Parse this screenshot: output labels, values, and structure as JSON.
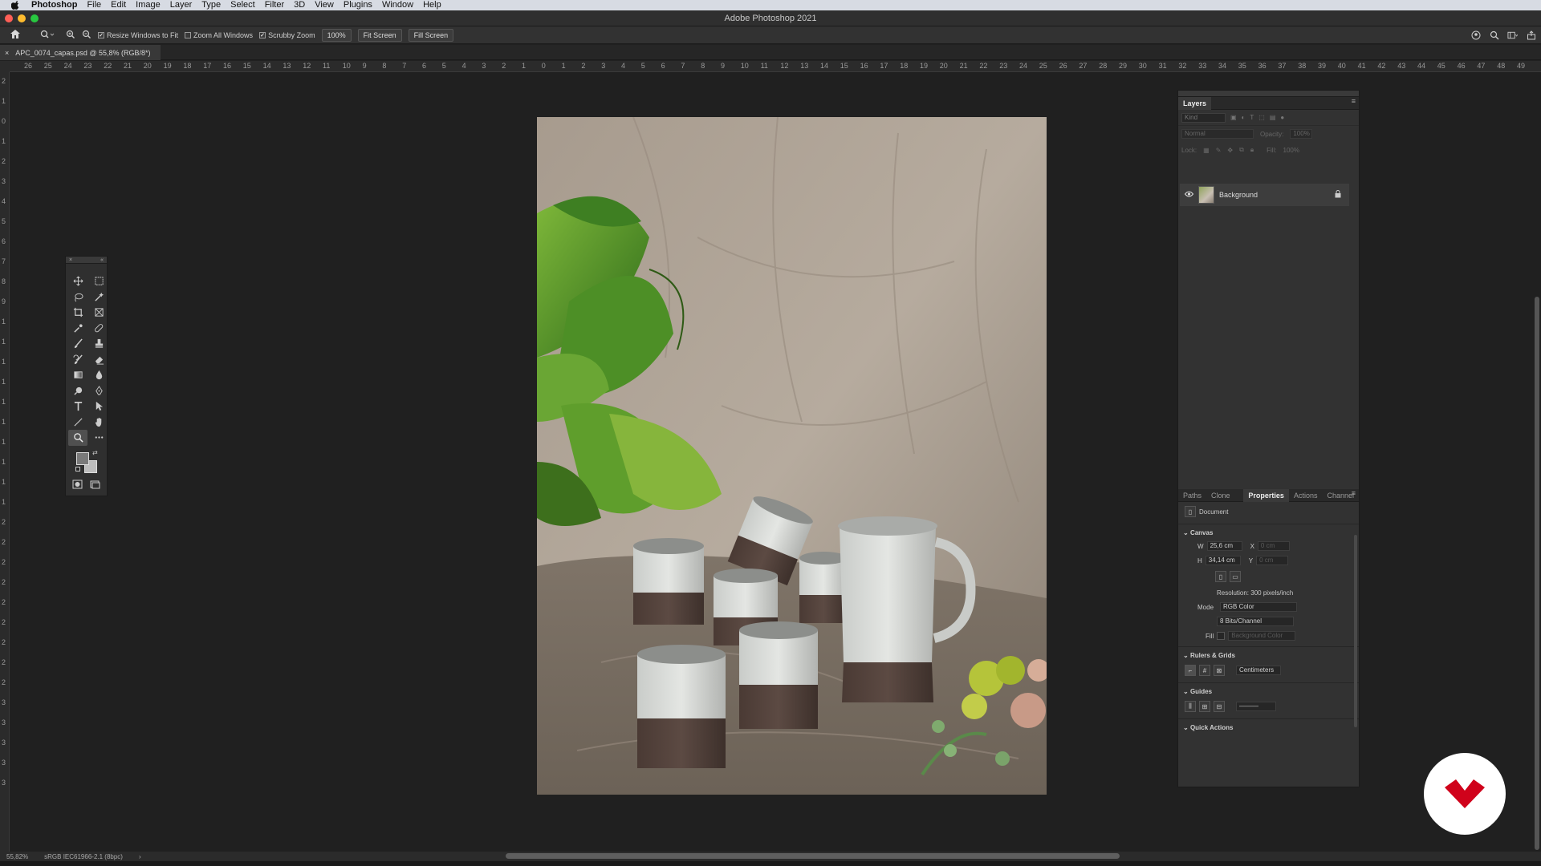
{
  "menubar": {
    "app_name": "Photoshop",
    "items": [
      "File",
      "Edit",
      "Image",
      "Layer",
      "Type",
      "Select",
      "Filter",
      "3D",
      "View",
      "Plugins",
      "Window",
      "Help"
    ]
  },
  "window": {
    "title": "Adobe Photoshop 2021"
  },
  "options_bar": {
    "resize_windows": "Resize Windows to Fit",
    "zoom_all": "Zoom All Windows",
    "scrubby_zoom": "Scrubby Zoom",
    "zoom_value": "100%",
    "fit_screen": "Fit Screen",
    "fill_screen": "Fill Screen",
    "resize_checked": true,
    "zoom_all_checked": false,
    "scrubby_checked": true
  },
  "document_tab": {
    "title": "APC_0074_capas.psd @ 55,8% (RGB/8*)",
    "close": "×"
  },
  "ruler_top": [
    "26",
    "25",
    "24",
    "23",
    "22",
    "21",
    "20",
    "19",
    "18",
    "17",
    "16",
    "15",
    "14",
    "13",
    "12",
    "11",
    "10",
    "9",
    "8",
    "7",
    "6",
    "5",
    "4",
    "3",
    "2",
    "1",
    "0",
    "1",
    "2",
    "3",
    "4",
    "5",
    "6",
    "7",
    "8",
    "9",
    "10",
    "11",
    "12",
    "13",
    "14",
    "15",
    "16",
    "17",
    "18",
    "19",
    "20",
    "21",
    "22",
    "23",
    "24",
    "25",
    "26",
    "27",
    "28",
    "29",
    "30",
    "31",
    "32",
    "33",
    "34",
    "35",
    "36",
    "37",
    "38",
    "39",
    "40",
    "41",
    "42",
    "43",
    "44",
    "45",
    "46",
    "47",
    "48",
    "49"
  ],
  "ruler_left": [
    "2",
    "1",
    "0",
    "1",
    "2",
    "3",
    "4",
    "5",
    "6",
    "7",
    "8",
    "9",
    "1",
    "1",
    "1",
    "1",
    "1",
    "1",
    "1",
    "1",
    "1",
    "1",
    "2",
    "2",
    "2",
    "2",
    "2",
    "2",
    "2",
    "2",
    "2",
    "3",
    "3",
    "3",
    "3",
    "3"
  ],
  "tools_panel": {
    "collapse": "«",
    "close": "×",
    "tools": [
      "move-tool",
      "marquee-tool",
      "lasso-tool",
      "magic-wand-tool",
      "crop-tool",
      "frame-tool",
      "eyedropper-tool",
      "healing-tool",
      "brush-tool",
      "stamp-tool",
      "history-brush-tool",
      "eraser-tool",
      "gradient-tool",
      "blur-tool",
      "dodge-tool",
      "pen-tool",
      "type-tool",
      "path-select-tool",
      "line-tool",
      "hand-tool",
      "zoom-tool",
      "more-tools"
    ]
  },
  "layers_panel": {
    "tab": "Layers",
    "kind_placeholder": "Kind",
    "blend_mode": "Normal",
    "opacity_label": "Opacity:",
    "opacity_value": "100%",
    "lock_label": "Lock:",
    "fill_label": "Fill:",
    "fill_value": "100%",
    "layers": [
      {
        "name": "Background",
        "visible": true,
        "locked": true
      }
    ]
  },
  "properties_panel": {
    "tabs": [
      "Paths",
      "Clone Sc",
      "Properties",
      "Actions",
      "Channel"
    ],
    "active_tab": "Properties",
    "doc_label": "Document",
    "canvas_header": "Canvas",
    "w_label": "W",
    "w_value": "25,6 cm",
    "h_label": "H",
    "h_value": "34,14 cm",
    "x_label": "X",
    "x_value": "0 cm",
    "y_label": "Y",
    "y_value": "0 cm",
    "resolution": "Resolution: 300 pixels/inch",
    "mode_label": "Mode",
    "mode_value": "RGB Color",
    "bits_value": "8 Bits/Channel",
    "fill_label": "Fill",
    "fill_value": "Background Color",
    "rulers_header": "Rulers & Grids",
    "units_value": "Centimeters",
    "guides_header": "Guides",
    "quick_actions_header": "Quick Actions"
  },
  "status_bar": {
    "zoom": "55,82%",
    "profile": "sRGB IEC61966-2.1 (8bpc)",
    "arrow": "›"
  },
  "colors": {
    "accent": "#d0021b",
    "ui_bg": "#202020",
    "panel_bg": "#323232"
  }
}
